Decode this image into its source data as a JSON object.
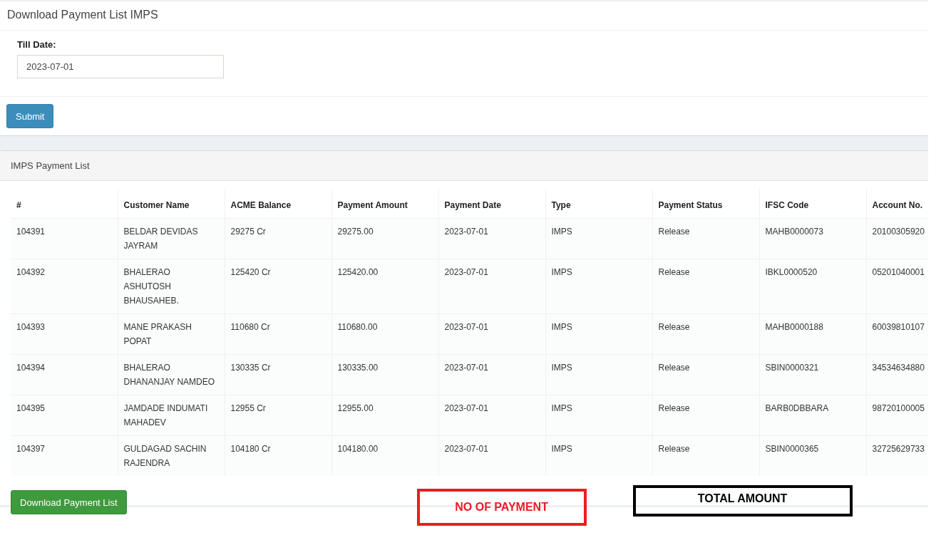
{
  "form_panel": {
    "title": "Download Payment List IMPS",
    "till_date": {
      "label": "Till Date:",
      "value": "2023-07-01"
    },
    "submit_button": "Submit"
  },
  "table_panel": {
    "title": "IMPS Payment List",
    "table": {
      "columns": [
        "#",
        "Customer Name",
        "ACME Balance",
        "Payment Amount",
        "Payment Date",
        "Type",
        "Payment Status",
        "IFSC Code",
        "Account No."
      ],
      "rows": [
        [
          "104391",
          "BELDAR DEVIDAS JAYRAM",
          "29275 Cr",
          "29275.00",
          "2023-07-01",
          "IMPS",
          "Release",
          "MAHB0000073",
          "20100305920"
        ],
        [
          "104392",
          "BHALERAO ASHUTOSH BHAUSAHEB.",
          "125420 Cr",
          "125420.00",
          "2023-07-01",
          "IMPS",
          "Release",
          "IBKL0000520",
          "05201040001"
        ],
        [
          "104393",
          "MANE PRAKASH POPAT",
          "110680 Cr",
          "110680.00",
          "2023-07-01",
          "IMPS",
          "Release",
          "MAHB0000188",
          "60039810107"
        ],
        [
          "104394",
          "BHALERAO DHANANJAY NAMDEO",
          "130335 Cr",
          "130335.00",
          "2023-07-01",
          "IMPS",
          "Release",
          "SBIN0000321",
          "34534634880"
        ],
        [
          "104395",
          "JAMDADE INDUMATI MAHADEV",
          "12955 Cr",
          "12955.00",
          "2023-07-01",
          "IMPS",
          "Release",
          "BARB0DBBARA",
          "98720100005"
        ],
        [
          "104397",
          "GULDAGAD SACHIN RAJENDRA",
          "104180 Cr",
          "104180.00",
          "2023-07-01",
          "IMPS",
          "Release",
          "SBIN0000365",
          "32725629733"
        ]
      ]
    },
    "download_button": "Download Payment List"
  },
  "annotations": [
    {
      "text": "NO OF PAYMENT",
      "color": "#ed1c24"
    },
    {
      "text": "TOTAL AMOUNT",
      "color": "#000000"
    }
  ]
}
